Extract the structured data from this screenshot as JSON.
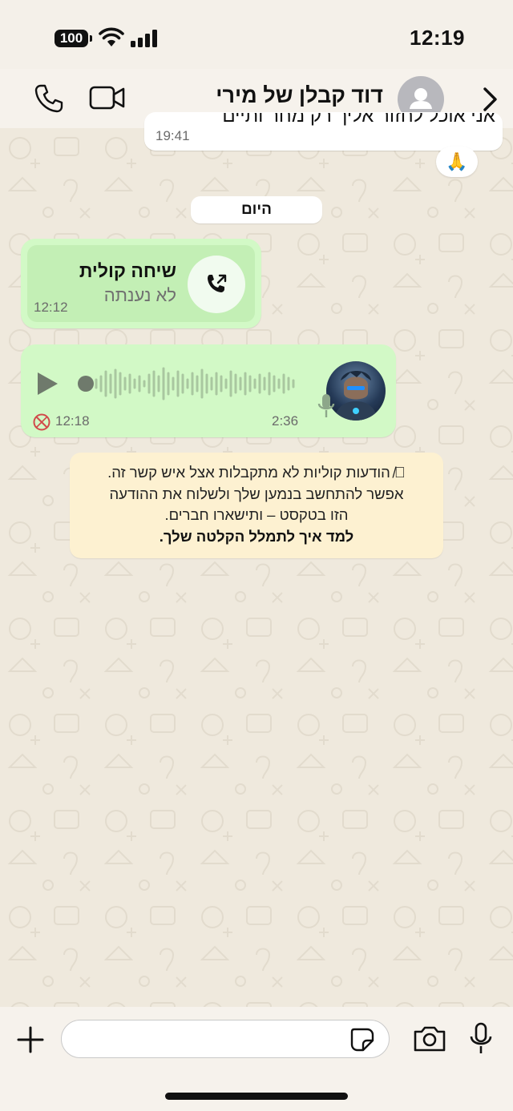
{
  "status_bar": {
    "battery": "100",
    "time": "12:19"
  },
  "header": {
    "contact_name": "דוד קבלן של מירי"
  },
  "chat": {
    "prev_message": {
      "text": "אני אוכל לחזור אליך רק מחר ותיים",
      "time": "19:41",
      "reaction": "🙏"
    },
    "date_label": "היום",
    "voice_call": {
      "title": "שיחה קולית",
      "subtitle": "לא נענתה",
      "time": "12:12"
    },
    "voice_message": {
      "duration": "2:36",
      "time": "12:18"
    },
    "notice": {
      "line1": "הודעות קוליות לא מתקבלות אצל איש קשר זה.",
      "line2": "אפשר להתחשב בנמען שלך ולשלוח את ההודעה",
      "line3": "הזו בטקסט – ותישארו חברים.",
      "learn": "למד איך לתמלל הקלטה שלך."
    }
  },
  "composer": {
    "placeholder": ""
  },
  "colors": {
    "bubble_green": "#d2f9c6",
    "notice_bg": "#fdf1d1",
    "chat_bg": "#efe9dd"
  },
  "icons": [
    "battery-icon",
    "wifi-icon",
    "signal-icon",
    "phone-icon",
    "video-icon",
    "back-chevron-icon",
    "default-avatar-icon",
    "pray-emoji",
    "call-outgoing-icon",
    "play-icon",
    "waveform",
    "mic-icon",
    "no-sync-icon",
    "muted-mic-icon",
    "plus-icon",
    "sticker-icon",
    "camera-icon",
    "microphone-icon"
  ]
}
